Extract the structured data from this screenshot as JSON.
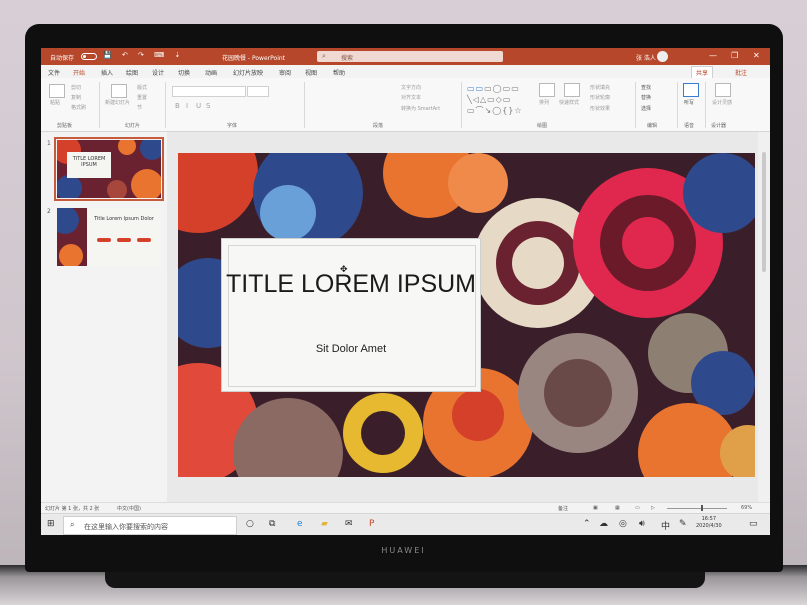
{
  "window": {
    "autosave_label": "自动保存",
    "qat_icons": "💾 ↶ ↷ ⌨ ⇣",
    "title": "花园晚餐 - PowerPoint",
    "search_placeholder": "搜索",
    "user_name": "张 浩人",
    "minimize": "—",
    "restore": "❐",
    "close": "✕"
  },
  "tabs": [
    "文件",
    "开始",
    "插入",
    "绘图",
    "设计",
    "切换",
    "动画",
    "幻灯片放映",
    "审阅",
    "视图",
    "帮助"
  ],
  "active_tab": "开始",
  "share_label": "共享",
  "comment_label": "批注",
  "ribbon": {
    "groups": [
      "剪贴板",
      "幻灯片",
      "字体",
      "段落",
      "绘图",
      "编辑",
      "语音",
      "设计器"
    ],
    "clipboard": {
      "paste": "粘贴",
      "cut": "剪切",
      "copy": "复制",
      "format_painter": "格式刷"
    },
    "slides": {
      "new_slide": "新建幻灯片",
      "layout": "版式",
      "reset": "重置",
      "section": "节"
    },
    "font": {
      "bold": "B",
      "italic": "I",
      "underline": "U",
      "strike": "S"
    },
    "paragraph": {
      "text_direction": "文字方向",
      "align_text": "对齐文本",
      "smartart": "转换为 SmartArt"
    },
    "drawing": {
      "arrange": "排列",
      "quick_styles": "快速样式",
      "fill": "形状填充",
      "outline": "形状轮廓",
      "effects": "形状效果"
    },
    "editing": {
      "find": "查找",
      "replace": "替换",
      "select": "选择"
    },
    "voice": {
      "dictate": "听写"
    },
    "designer": {
      "design_ideas": "设计灵感"
    }
  },
  "slides": [
    {
      "number": "1",
      "title": "TITLE LOREM IPSUM",
      "subtitle": "Sit Dolor Amet"
    },
    {
      "number": "2",
      "title": "Title Lorem Ipsum Dolor"
    }
  ],
  "current_slide": {
    "title": "TITLE LOREM IPSUM",
    "subtitle": "Sit Dolor Amet"
  },
  "status": {
    "slide_count": "幻灯片 第 1 张，共 2 张",
    "language": "中文(中国)",
    "notes": "备注",
    "zoom": "69%"
  },
  "taskbar": {
    "search_placeholder": "在这里输入你要搜索的内容",
    "time": "16:57",
    "date": "2020/4/30",
    "ime": "中"
  },
  "device": {
    "brand": "HUAWEI"
  },
  "colors": {
    "accent": "#b7472a",
    "slide_bg": "#3a1f2a"
  }
}
